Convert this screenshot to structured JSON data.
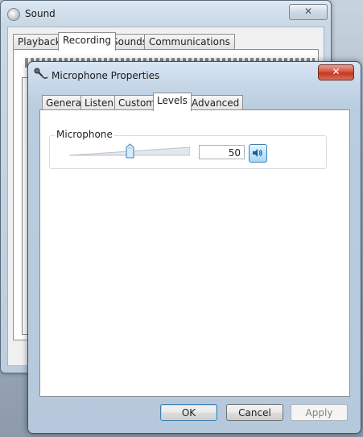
{
  "sound_window": {
    "title": "Sound",
    "close_glyph": "✕",
    "tabs": [
      {
        "label": "Playback",
        "active": false
      },
      {
        "label": "Recording",
        "active": true
      },
      {
        "label": "Sounds",
        "active": false
      },
      {
        "label": "Communications",
        "active": false
      }
    ]
  },
  "mic_window": {
    "title": "Microphone Properties",
    "close_glyph": "✕",
    "tabs": [
      {
        "label": "General",
        "active": false
      },
      {
        "label": "Listen",
        "active": false
      },
      {
        "label": "Custom",
        "active": false
      },
      {
        "label": "Levels",
        "active": true
      },
      {
        "label": "Advanced",
        "active": false
      }
    ],
    "levels": {
      "group_label": "Microphone",
      "level_value": "50",
      "slider_fraction": 0.5,
      "speaker_icon": "speaker-icon"
    },
    "buttons": {
      "ok": "OK",
      "cancel": "Cancel",
      "apply": "Apply"
    }
  }
}
